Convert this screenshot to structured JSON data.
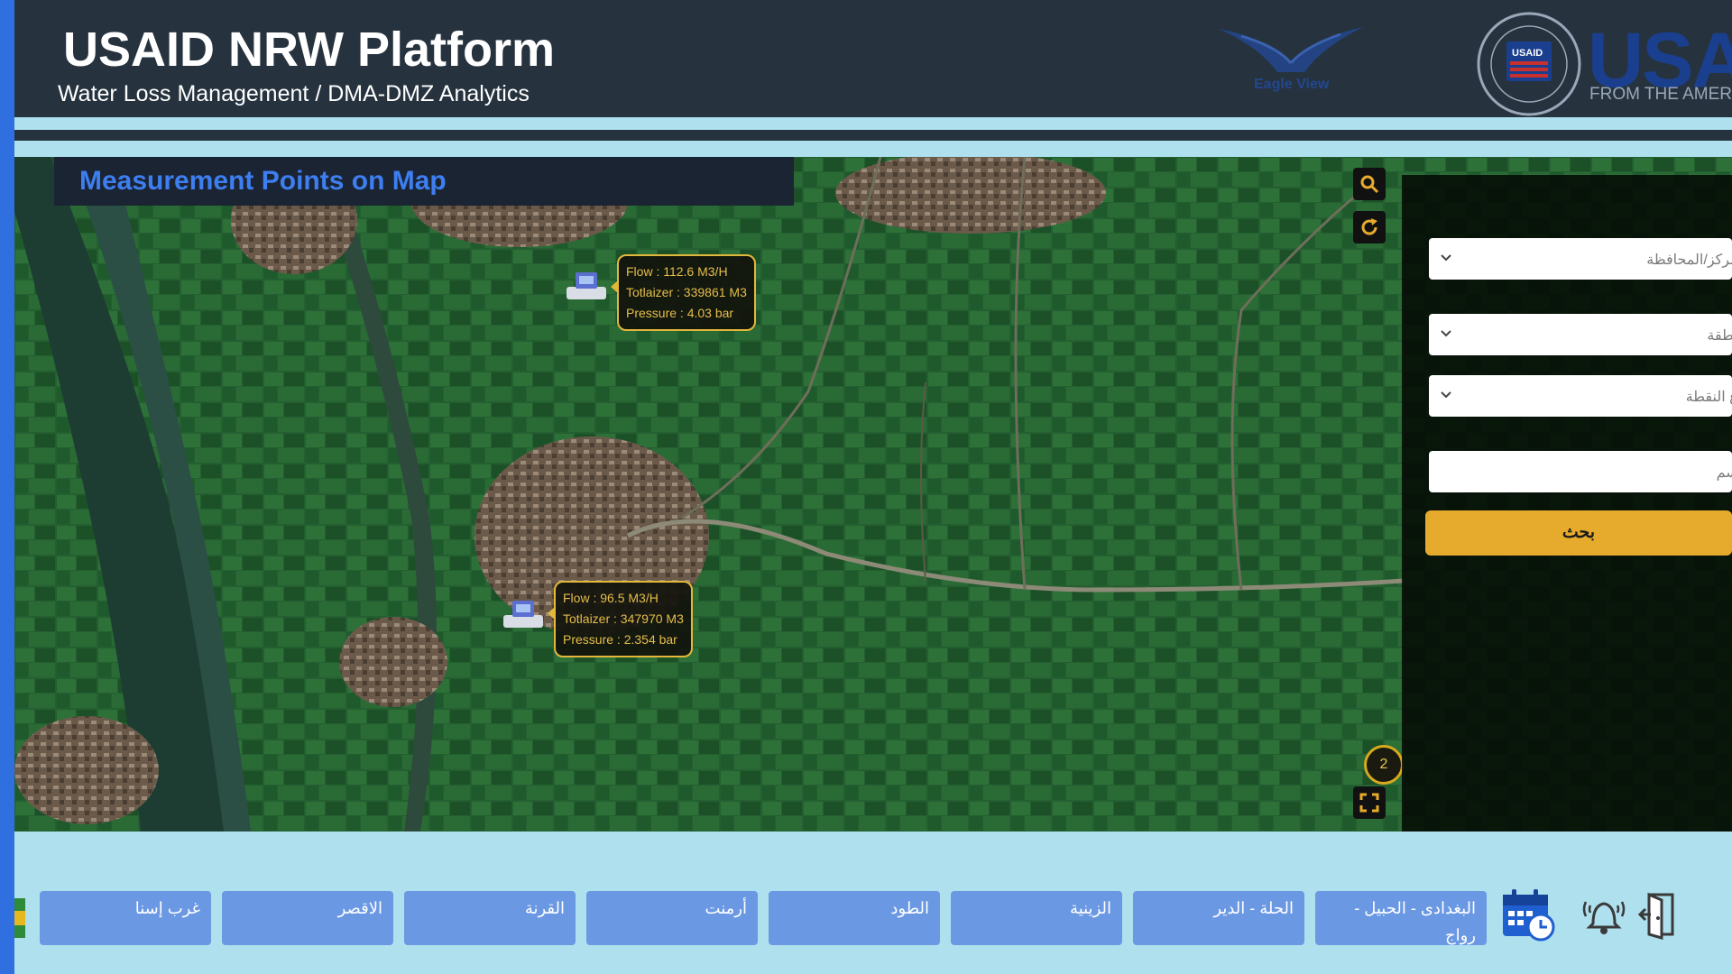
{
  "header": {
    "title": "USAID NRW Platform",
    "subtitle": "Water Loss Management / DMA-DMZ Analytics",
    "eagle_logo_text": "Eagle View",
    "usaid_wordmark": "USAI",
    "usaid_tagline": "FROM THE AMERICAN",
    "seal_text": "USAID"
  },
  "map": {
    "heading": "Measurement Points on Map",
    "cluster_count": "2",
    "meters": [
      {
        "flow": "Flow : 112.6 M3/H",
        "totalizer": "Totlaizer : 339861 M3",
        "pressure": "Pressure : 4.03 bar"
      },
      {
        "flow": "Flow : 96.5 M3/H",
        "totalizer": "Totlaizer : 347970 M3",
        "pressure": "Pressure : 2.354 bar"
      }
    ],
    "controls": {
      "search_icon": "search-icon",
      "refresh_icon": "refresh-icon",
      "fullscreen_icon": "fullscreen-icon"
    }
  },
  "search_panel": {
    "governorate_placeholder": "...مركز/المحافظة",
    "region_placeholder": "...نطقة",
    "point_type_placeholder": "...ع النقطة",
    "name_placeholder": "...سم",
    "search_button": "بحث"
  },
  "bottom_bar": {
    "cities": [
      "غرب إسنا",
      "الاقصر",
      "القرنة",
      "أرمنت",
      "الطود",
      "الزينية",
      "الحلة - الدير",
      "البغدادى - الحبيل - رواج"
    ],
    "icons": [
      "calendar-clock-icon",
      "alarm-bell-icon",
      "logout-door-icon"
    ]
  },
  "colors": {
    "header_bg": "#26333f",
    "accent_blue": "#3d7ef0",
    "city_button": "#6a98e3",
    "search_button": "#e6ab2c",
    "tooltip_border": "#e3b83a"
  }
}
